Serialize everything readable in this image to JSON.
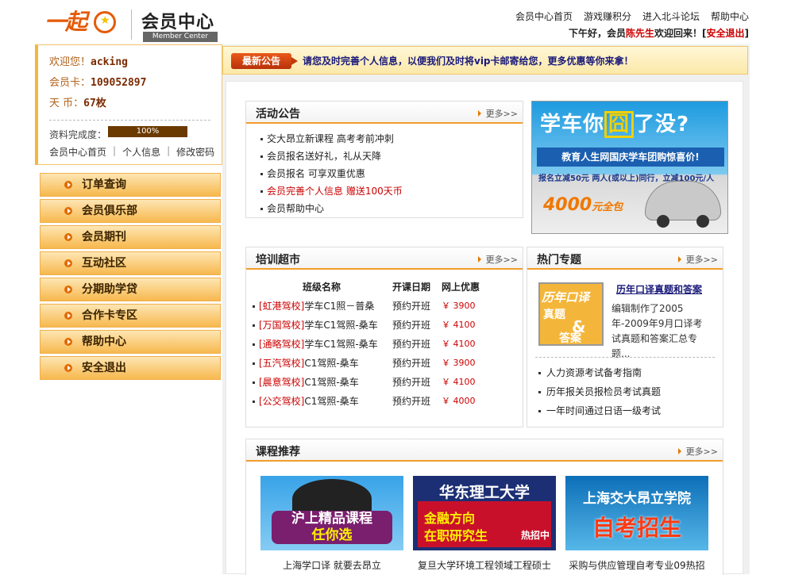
{
  "header": {
    "logo_text": "一起",
    "title": "会员中心",
    "subtitle": "Member Center",
    "nav": [
      "会员中心首页",
      "游戏赚积分",
      "进入北斗论坛",
      "帮助中心"
    ],
    "welcome_pre": "下午好，会员",
    "welcome_name": "陈先生",
    "welcome_post": "欢迎回来！[",
    "logout": "安全退出",
    "welcome_close": "]"
  },
  "user": {
    "greeting": "欢迎您！",
    "username": "acking",
    "card_label": "会员卡：",
    "card_no": "109052897",
    "coin_label": "天 币：",
    "coins": "67枚",
    "profile_label": "资料完成度：",
    "profile_pct_text": "100%",
    "profile_pct": 100,
    "links": [
      "会员中心首页",
      "个人信息",
      "修改密码"
    ],
    "link_sep": "|"
  },
  "menu": [
    "订单查询",
    "会员俱乐部",
    "会员期刊",
    "互动社区",
    "分期助学贷",
    "合作卡专区",
    "帮助中心",
    "安全退出"
  ],
  "notice": {
    "badge": "最新公告",
    "text": "请您及时完善个人信息，以便我们及时将vip卡邮寄给您，更多优惠等你来拿！"
  },
  "more": "更多>>",
  "activity": {
    "title": "活动公告",
    "items": [
      {
        "text": "交大昂立新课程 高考考前冲刺",
        "hot": false
      },
      {
        "text": "会员报名送好礼，礼从天降",
        "hot": false
      },
      {
        "text": "会员报名 可享双重优惠",
        "hot": false
      },
      {
        "text": "会员完善个人信息 赠送100天币",
        "hot": true
      },
      {
        "text": "会员帮助中心",
        "hot": false
      }
    ]
  },
  "ad": {
    "line1_pre": "学车你",
    "line1_box": "囧",
    "line1_post": "了没?",
    "line2": "教育人生网国庆学车团购惊喜价!",
    "line3": "报名立减50元  两人(或以上)同行，立减100元/人",
    "price": "4000",
    "price_suffix": "元全包"
  },
  "training": {
    "title": "培训超市",
    "headers": [
      "班级名称",
      "开课日期",
      "网上优惠"
    ],
    "rows": [
      {
        "school": "[虹港驾校]",
        "course": "学车C1照－普桑",
        "date": "预约开班",
        "price": "￥ 3900"
      },
      {
        "school": "[万国驾校]",
        "course": "学车C1驾照-桑车",
        "date": "预约开班",
        "price": "￥ 4100"
      },
      {
        "school": "[通略驾校]",
        "course": "学车C1驾照-桑车",
        "date": "预约开班",
        "price": "￥ 4100"
      },
      {
        "school": "[五汽驾校]",
        "course": "C1驾照-桑车",
        "date": "预约开班",
        "price": "￥ 3900"
      },
      {
        "school": "[晨意驾校]",
        "course": "C1驾照-桑车",
        "date": "预约开班",
        "price": "￥ 4100"
      },
      {
        "school": "[公交驾校]",
        "course": "C1驾照-桑车",
        "date": "预约开班",
        "price": "￥ 4000"
      }
    ]
  },
  "topics": {
    "title": "热门专题",
    "img_lines": [
      "历年口译",
      "真题",
      "&",
      "答案"
    ],
    "feature_title": "历年口译真题和答案",
    "feature_desc": "编辑制作了2005年-2009年9月口译考试真题和答案汇总专题...",
    "items": [
      "人力资源考试备考指南",
      "历年报关员报检员考试真题",
      "一年时间通过日语一级考试"
    ]
  },
  "courses": {
    "title": "课程推荐",
    "cards": [
      {
        "l1": "沪上精品课程",
        "l2": "任你选",
        "caption": "上海学口译 就要去昂立"
      },
      {
        "l1": "华东理工大学",
        "l2": "金融方向",
        "l3": "在职研究生",
        "l4": "热招中",
        "caption": "复旦大学环境工程领域工程硕士"
      },
      {
        "l1": "上海交大昂立学院",
        "l2": "自考招生",
        "caption": "采购与供应管理自考专业09热招"
      }
    ]
  }
}
